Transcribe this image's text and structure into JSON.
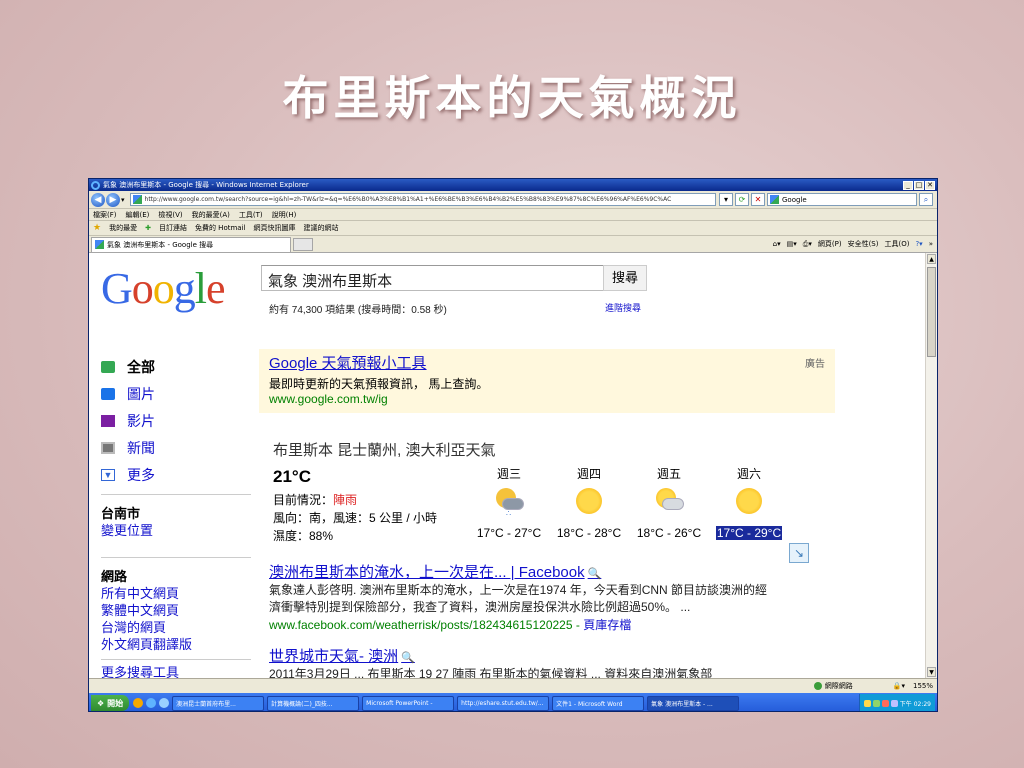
{
  "slide": {
    "title": "布里斯本的天氣概況"
  },
  "window": {
    "title": "氣象 澳洲布里斯本 - Google 搜尋 - Windows Internet Explorer",
    "address": "http://www.google.com.tw/search?source=ig&hl=zh-TW&rlz=&q=%E6%B0%A3%E8%B1%A1+%E6%BE%B3%E6%B4%B2%E5%B8%83%E9%87%8C%E6%96%AF%E6%9C%AC",
    "search_engine": "Google",
    "menus": [
      "檔案(F)",
      "編輯(E)",
      "檢視(V)",
      "我的最愛(A)",
      "工具(T)",
      "說明(H)"
    ],
    "favorites": [
      "我的最愛",
      "目訂連結",
      "免費的 Hotmail",
      "網頁快訊圖庫",
      "建議的網站"
    ],
    "tab_label": "氣象 澳洲布里斯本 - Google 搜尋",
    "commands": [
      "網頁(P)",
      "安全性(S)",
      "工具(O)"
    ],
    "status_zone": "網際網路",
    "zoom": "155%"
  },
  "google": {
    "logo": "Google",
    "query": "氣象 澳洲布里斯本",
    "search_button": "搜尋",
    "stats": "約有 74,300 項結果 (搜尋時間：0.58 秒)",
    "advanced": "進階搜尋",
    "nav": [
      {
        "label": "全部",
        "icon": "all-results-icon",
        "color": "#34a853"
      },
      {
        "label": "圖片",
        "icon": "images-icon",
        "color": "#1a73e8"
      },
      {
        "label": "影片",
        "icon": "videos-icon",
        "color": "#7b1fa2"
      },
      {
        "label": "新聞",
        "icon": "news-icon",
        "color": "#777777"
      },
      {
        "label": "更多",
        "icon": "more-icon",
        "color": "#3367d6"
      }
    ],
    "location": {
      "city": "台南市",
      "change": "變更位置"
    },
    "web": {
      "heading": "網路",
      "links": [
        "所有中文網頁",
        "繁體中文網頁",
        "台灣的網頁",
        "外文網頁翻譯版"
      ]
    },
    "more_tools": "更多搜尋工具",
    "ad": {
      "title": "Google 天氣預報小工具",
      "desc": "最即時更新的天氣預報資訊， 馬上查詢。",
      "url": "www.google.com.tw/ig",
      "label": "廣告"
    },
    "weather": {
      "title": "布里斯本 昆士蘭州, 澳大利亞天氣",
      "temp": "21°C",
      "condition_label": "目前情況：",
      "condition": "陣雨",
      "wind": "風向：南，風速：5 公里 / 小時",
      "humidity": "濕度：88%",
      "days": [
        {
          "name": "週三",
          "range": "17°C - 27°C",
          "icon": "cloud-rain-icon"
        },
        {
          "name": "週四",
          "range": "18°C - 28°C",
          "icon": "sun-icon"
        },
        {
          "name": "週五",
          "range": "18°C - 26°C",
          "icon": "partly-cloudy-icon"
        },
        {
          "name": "週六",
          "range": "17°C - 29°C",
          "icon": "sun-icon"
        }
      ]
    },
    "results": [
      {
        "title": "澳洲布里斯本的淹水，上一次是在... | Facebook",
        "snippet_l1": "氣象達人彭啓明. 澳洲布里斯本的淹水，上一次是在1974 年，今天看到CNN 節目訪談澳洲的經",
        "snippet_l2": "濟衝擊特別提到保險部分，我查了資料，澳洲房屋投保洪水險比例超過50%。 ...",
        "url": "www.facebook.com/weatherrisk/posts/182434615120225",
        "cache": "頁庫存檔"
      },
      {
        "title": "世界城市天氣- 澳洲",
        "snippet_l1": "2011年3月29日 ... 布里斯本 19 27 陣雨 布里斯本的氣候資料 ... 資料來自澳洲氣象部"
      }
    ]
  },
  "taskbar": {
    "start": "開始",
    "tasks": [
      "澳洲昆士蘭首府布里...",
      "計算機概論(二)_四技...",
      "Microsoft PowerPoint -",
      "http://eshare.stut.edu.tw/...",
      "文件1 - Microsoft Word",
      "氣象 澳洲布里斯本 - ..."
    ],
    "clock": "下午 02:29"
  }
}
